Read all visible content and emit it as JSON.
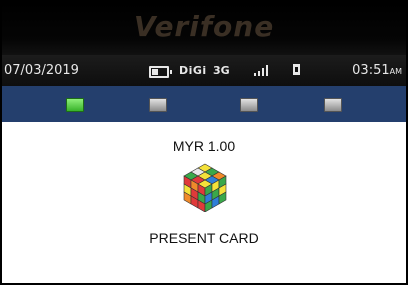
{
  "brand": {
    "name": "Verifone"
  },
  "status_bar": {
    "date": "07/03/2019",
    "carrier": "DiGi",
    "network": "3G",
    "time": "03:51",
    "time_suffix": "AM",
    "icons": [
      "battery-icon",
      "signal-icon",
      "sim-icon"
    ]
  },
  "menu_keys": [
    {
      "name": "menu-key-1",
      "state": "active"
    },
    {
      "name": "menu-key-2",
      "state": "inactive"
    },
    {
      "name": "menu-key-3",
      "state": "inactive"
    },
    {
      "name": "menu-key-4",
      "state": "inactive"
    }
  ],
  "transaction": {
    "amount": "MYR 1.00",
    "prompt": "PRESENT CARD",
    "icon": "rubiks-cube-icon"
  },
  "colors": {
    "menu_bar": "#243f6d",
    "active_key": "#38b32a",
    "inactive_key": "#9a9a9a",
    "status_bar": "#111111"
  }
}
